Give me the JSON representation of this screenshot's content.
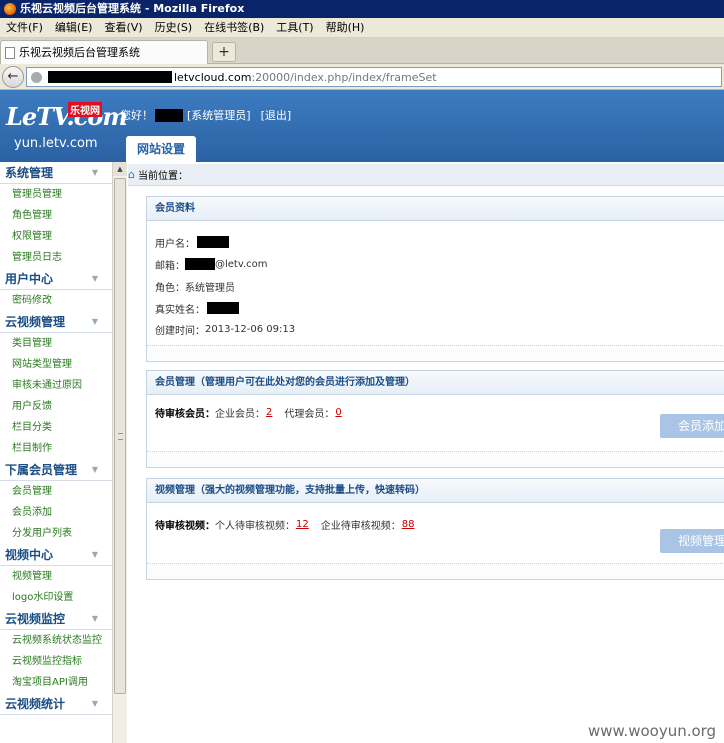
{
  "browser": {
    "window_title": "乐视云视频后台管理系统 - Mozilla Firefox",
    "menu": [
      "文件(F)",
      "编辑(E)",
      "查看(V)",
      "历史(S)",
      "在线书签(B)",
      "工具(T)",
      "帮助(H)"
    ],
    "tab_title": "乐视云视频后台管理系统",
    "new_tab_label": "+",
    "back_label": "←",
    "url_host": "letvcloud.com",
    "url_path": ":20000/index.php/index/frameSet"
  },
  "header": {
    "logo_text": "LeTV.com",
    "logo_cn": "乐视网",
    "logo_sub": "yun.letv.com",
    "greeting_prefix": "您好！",
    "role_link": "[系统管理员]",
    "logout_link": "[退出]",
    "active_tab": "网站设置"
  },
  "sidebar": {
    "sections": [
      {
        "title": "系统管理",
        "items": [
          "管理员管理",
          "角色管理",
          "权限管理",
          "管理员日志"
        ]
      },
      {
        "title": "用户中心",
        "items": [
          "密码修改"
        ]
      },
      {
        "title": "云视频管理",
        "items": [
          "类目管理",
          "网站类型管理",
          "审核未通过原因",
          "用户反馈",
          "栏目分类",
          "栏目制作"
        ]
      },
      {
        "title": "下属会员管理",
        "items": [
          "会员管理",
          "会员添加",
          "分发用户列表"
        ]
      },
      {
        "title": "视频中心",
        "items": [
          "视频管理",
          "logo水印设置"
        ]
      },
      {
        "title": "云视频监控",
        "items": [
          "云视频系统状态监控",
          "云视频监控指标",
          "淘宝项目API调用"
        ]
      },
      {
        "title": "云视频统计",
        "items": []
      }
    ]
  },
  "breadcrumb": {
    "label": "当前位置："
  },
  "profile": {
    "title": "会员资料",
    "username_label": "用户名：",
    "email_label": "邮箱：",
    "email_suffix": "@letv.com",
    "role_label": "角色：",
    "role_value": "系统管理员",
    "realname_label": "真实姓名：",
    "created_label": "创建时间：",
    "created_value": "2013-12-06 09:13"
  },
  "member_mgmt": {
    "title": "会员管理（管理用户可在此处对您的会员进行添加及管理）",
    "pending_label": "待审核会员：",
    "enterprise_label": "企业会员：",
    "enterprise_count": "2",
    "agent_label": "代理会员：",
    "agent_count": "0",
    "button_label": "会员添加"
  },
  "video_mgmt": {
    "title": "视频管理（强大的视频管理功能，支持批量上传，快速转码）",
    "pending_label": "待审核视频：",
    "personal_label": "个人待审核视频：",
    "personal_count": "12",
    "enterprise_label": "企业待审核视频：",
    "enterprise_count": "88",
    "button_label": "视频管理"
  },
  "watermark": "www.wooyun.org"
}
